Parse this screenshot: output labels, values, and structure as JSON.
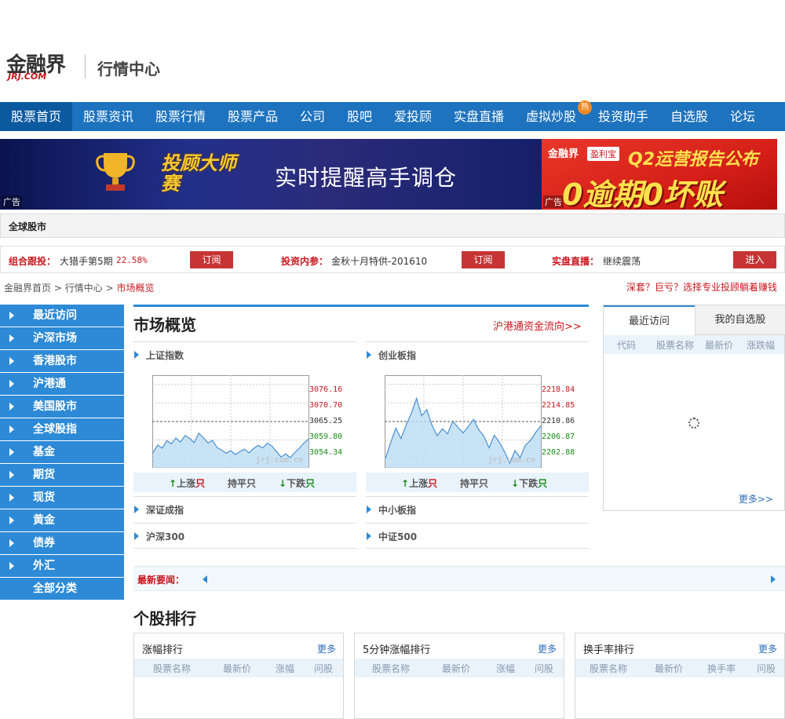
{
  "header": {
    "logo_text": "金融界",
    "logo_sub": "JRJ.COM",
    "title": "行情中心"
  },
  "nav": {
    "items": [
      "股票首页",
      "股票资讯",
      "股票行情",
      "股票产品",
      "公司",
      "股吧",
      "爱投顾",
      "实盘直播",
      "虚拟炒股",
      "投资助手",
      "自选股",
      "论坛"
    ],
    "hot_badge": "热"
  },
  "banners": {
    "left_tag": "投顾大师赛",
    "left_text": "实时提醒高手调仓",
    "right_brand": "金融界",
    "right_brand2": "盈利宝",
    "right_title": "Q2运营报告公布",
    "right_big": "0逾期0坏账",
    "ad_label": "广告"
  },
  "global_market": {
    "label": "全球股市"
  },
  "subscribe": {
    "combo_label": "组合跟投：",
    "combo_name": "大猎手第5期",
    "combo_pct": "22.58%",
    "combo_btn": "订阅",
    "invest_label": "投资内参：",
    "invest_name": "金秋十月特供-201610",
    "invest_btn": "订阅",
    "live_label": "实盘直播：",
    "live_name": "继续震荡",
    "live_btn": "进入"
  },
  "breadcrumb": {
    "home": "金融界首页",
    "sep": ">",
    "center": "行情中心",
    "current": "市场概览"
  },
  "promo": "深套？巨亏？选择专业投顾躺着赚钱",
  "sidebar": {
    "items": [
      "最近访问",
      "沪深市场",
      "香港股市",
      "沪港通",
      "美国股市",
      "全球股指",
      "基金",
      "期货",
      "现货",
      "黄金",
      "债券",
      "外汇"
    ],
    "all": "全部分类"
  },
  "market": {
    "title": "市场概览",
    "link": "沪港通资金流向>>",
    "left": {
      "index_name": "上证指数",
      "ticks": [
        "3076.16",
        "3070.70",
        "3065.25",
        "3059.80",
        "3054.34"
      ],
      "watermark": "jrj.com.cn",
      "up": "上涨",
      "flat": "持平",
      "down": "下跌",
      "unit": "只",
      "more_rows": [
        "深证成指",
        "沪深300"
      ]
    },
    "right": {
      "index_name": "创业板指",
      "ticks": [
        "2218.84",
        "2214.85",
        "2210.86",
        "2206.87",
        "2202.88"
      ],
      "watermark": "jrj.com.cn",
      "up": "上涨",
      "flat": "持平",
      "down": "下跌",
      "unit": "只",
      "more_rows": [
        "中小板指",
        "中证500"
      ]
    }
  },
  "chart_data": [
    {
      "type": "area",
      "title": "上证指数",
      "ylim": [
        3051.6,
        3078.9
      ],
      "y_ticks": [
        3076.16,
        3070.7,
        3065.25,
        3059.8,
        3054.34
      ],
      "values": [
        3056.1,
        3058.3,
        3057.4,
        3059.6,
        3058.7,
        3060.4,
        3059.2,
        3061.1,
        3060.3,
        3059.0,
        3061.8,
        3060.5,
        3058.9,
        3059.7,
        3057.6,
        3056.8,
        3055.9,
        3056.7,
        3055.5,
        3056.4,
        3057.1,
        3056.0,
        3057.3,
        3058.2,
        3057.5,
        3058.9,
        3058.0,
        3056.4,
        3054.8,
        3055.7,
        3054.6,
        3056.1,
        3057.4,
        3058.9,
        3060.1
      ]
    },
    {
      "type": "area",
      "title": "创业板指",
      "ylim": [
        2200.9,
        2220.8
      ],
      "y_ticks": [
        2218.84,
        2214.85,
        2210.86,
        2206.87,
        2202.88
      ],
      "values": [
        2202.9,
        2206.3,
        2209.4,
        2207.2,
        2210.1,
        2212.6,
        2215.8,
        2212.1,
        2213.4,
        2210.0,
        2207.8,
        2209.3,
        2208.2,
        2210.9,
        2209.6,
        2208.4,
        2209.8,
        2211.3,
        2209.1,
        2207.7,
        2205.2,
        2207.9,
        2206.4,
        2204.3,
        2201.9,
        2204.6,
        2203.1,
        2205.7,
        2206.8,
        2208.5,
        2209.9
      ]
    }
  ],
  "right_panel": {
    "tab_active": "最近访问",
    "tab_inactive": "我的自选股",
    "headers": [
      "代码",
      "股票名称",
      "最新价",
      "涨跌幅"
    ],
    "more": "更多>>"
  },
  "news": {
    "label": "最新要闻："
  },
  "ranking": {
    "title": "个股排行",
    "boxes": [
      {
        "title": "涨幅排行",
        "more": "更多",
        "headers": [
          "股票名称",
          "最新价",
          "涨幅",
          "问股"
        ]
      },
      {
        "title": "5分钟涨幅排行",
        "more": "更多",
        "headers": [
          "股票名称",
          "最新价",
          "涨幅",
          "问股"
        ]
      },
      {
        "title": "换手率排行",
        "more": "更多",
        "headers": [
          "股票名称",
          "最新价",
          "换手率",
          "问股"
        ]
      }
    ]
  }
}
